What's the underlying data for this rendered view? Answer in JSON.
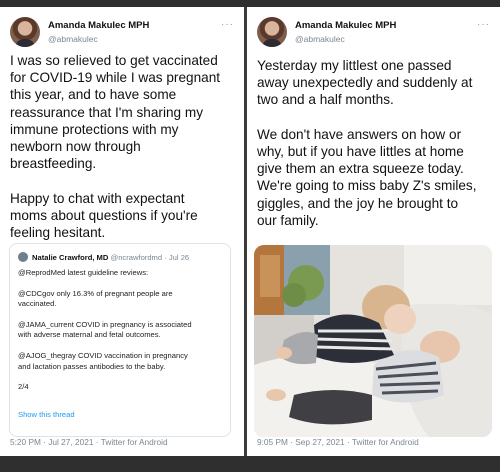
{
  "left_tweet": {
    "name": "Amanda Makulec MPH",
    "handle": "@abmakulec",
    "more": "···",
    "text": "I was so relieved to get vaccinated\nfor COVID-19 while I was pregnant\nthis year, and to have some\nreassurance that I'm sharing my\nimmune protections with my\nnewborn now through\nbreastfeeding.\n\nHappy to chat with expectant\nmoms about questions if you're\nfeeling hesitant.",
    "quote": {
      "name": "Natalie Crawford, MD",
      "handle": "@ncrawfordmd",
      "date": "· Jul 26",
      "text": "@ReprodMed latest guideline reviews:\n\n@CDCgov only 16.3% of pregnant people are\nvaccinated.\n\n@JAMA_current COVID in pregnancy is associated\nwith adverse maternal and fetal outcomes.\n\n@AJOG_thegray COVID vaccination in pregnancy\nand lactation passes antibodies to the baby.\n\n2/4",
      "link": "Show this thread"
    },
    "timestamp": "5:20 PM · Jul 27, 2021 ·",
    "source": "Twitter for Android"
  },
  "right_tweet": {
    "name": "Amanda Makulec MPH",
    "handle": "@abmakulec",
    "more": "···",
    "text": "Yesterday my littlest one passed\naway unexpectedly and suddenly at\ntwo and a half months.\n\nWe don't have answers on how or\nwhy, but if you have littles at home\ngive them an extra squeeze today.\nWe're going to miss baby Z's smiles,\ngiggles, and the joy he brought to\nour family.",
    "timestamp": "9:05 PM · Sep 27, 2021 ·",
    "source": "Twitter for Android"
  }
}
